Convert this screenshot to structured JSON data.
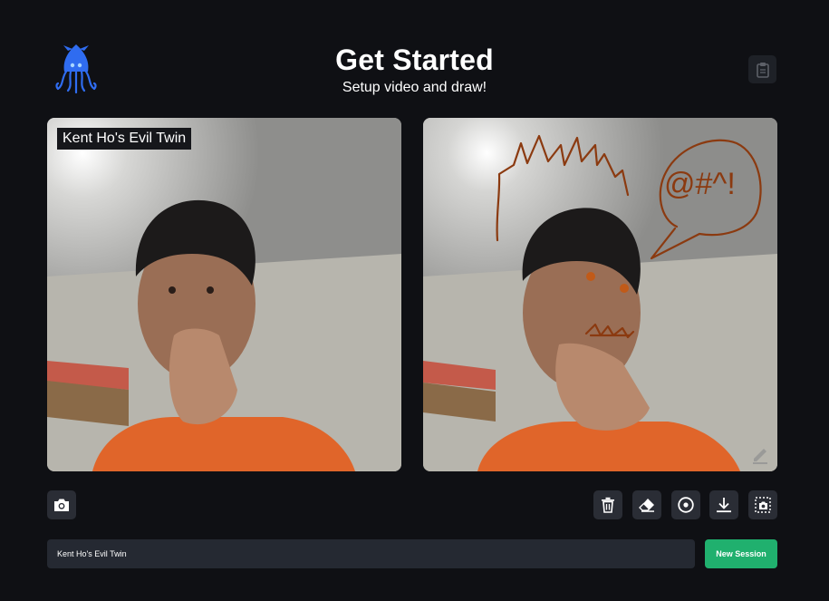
{
  "header": {
    "title": "Get Started",
    "subtitle": "Setup video and draw!"
  },
  "logo": {
    "icon": "squid-logo-icon"
  },
  "clipboard": {
    "icon": "clipboard-icon"
  },
  "videos": {
    "local": {
      "name_tag": "Kent Ho's Evil Twin"
    },
    "remote": {
      "edit_icon": "pencil-icon",
      "annotation_text": "@#^!"
    }
  },
  "toolbar": {
    "left": [
      {
        "icon": "camera-icon"
      }
    ],
    "right": [
      {
        "icon": "trash-icon"
      },
      {
        "icon": "eraser-icon"
      },
      {
        "icon": "record-circle-icon"
      },
      {
        "icon": "download-icon"
      },
      {
        "icon": "screenshot-icon"
      }
    ]
  },
  "session": {
    "name_value": "Kent Ho's Evil Twin",
    "new_session_label": "New Session"
  },
  "colors": {
    "background": "#0f1014",
    "button": "#2a2d35",
    "input": "#252932",
    "accent_green": "#20b06e",
    "drawing": "#8b3a10",
    "logo_blue": "#2f6cf0"
  }
}
